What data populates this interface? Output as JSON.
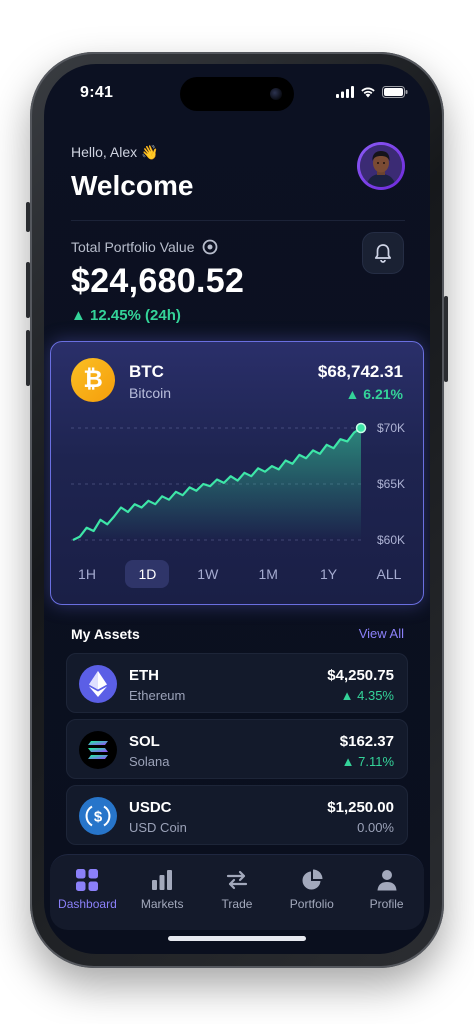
{
  "status": {
    "time": "9:41"
  },
  "header": {
    "greeting": "Hello, Alex",
    "greeting_emoji": "👋",
    "title": "Welcome",
    "avatar": "avatar-icon"
  },
  "portfolio": {
    "label": "Total Portfolio Value",
    "value": "$24,680.52",
    "change": "▲ 12.45% (24h)",
    "change_color": "#34d399"
  },
  "featured": {
    "symbol": "BTC",
    "name": "Bitcoin",
    "coin_glyph": "₿",
    "price": "$68,742.31",
    "change": "▲ 6.21%",
    "coin_color": "#f59e0b",
    "accent_color": "#34d399"
  },
  "chart_data": {
    "type": "area",
    "y_ticks": [
      "$70K",
      "$65K",
      "$60K"
    ],
    "ylim": [
      60000,
      70000
    ],
    "values": [
      60000,
      60300,
      61100,
      60800,
      61800,
      61400,
      62100,
      62900,
      62500,
      63200,
      62900,
      63500,
      63200,
      63900,
      63600,
      64300,
      64000,
      64700,
      64400,
      65000,
      64800,
      65400,
      65100,
      65700,
      65300,
      66000,
      65700,
      66400,
      66100,
      66600,
      66300,
      67100,
      66800,
      67600,
      67300,
      68000,
      67700,
      68500,
      68200,
      69000,
      68800,
      69600,
      70000
    ]
  },
  "timeframes": [
    "1H",
    "1D",
    "1W",
    "1M",
    "1Y",
    "ALL"
  ],
  "timeframe_active": "1D",
  "assets": {
    "title": "My Assets",
    "view_all": "View All",
    "items": [
      {
        "symbol": "ETH",
        "name": "Ethereum",
        "price": "$4,250.75",
        "change": "▲ 4.35%",
        "icon": "ethereum-icon",
        "change_color": "#34d399"
      },
      {
        "symbol": "SOL",
        "name": "Solana",
        "price": "$162.37",
        "change": "▲ 7.11%",
        "icon": "solana-icon",
        "change_color": "#34d399"
      },
      {
        "symbol": "USDC",
        "name": "USD Coin",
        "price": "$1,250.00",
        "change": "0.00%",
        "icon": "usdc-icon",
        "change_color": "#9ba2b8"
      }
    ]
  },
  "nav": [
    {
      "label": "Dashboard",
      "icon": "grid-icon"
    },
    {
      "label": "Markets",
      "icon": "bar-chart-icon"
    },
    {
      "label": "Trade",
      "icon": "swap-icon"
    },
    {
      "label": "Portfolio",
      "icon": "pie-chart-icon"
    },
    {
      "label": "Profile",
      "icon": "person-icon"
    }
  ],
  "nav_active": "Dashboard"
}
